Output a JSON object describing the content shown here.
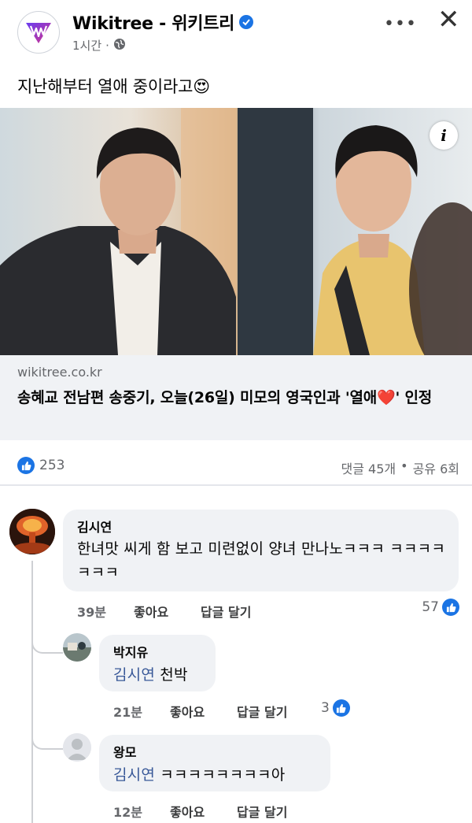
{
  "post": {
    "page_name": "Wikitree - 위키트리",
    "time": "1시간",
    "separator": "·",
    "text": "지난해부터 열애 중이라고",
    "emoji": "😍",
    "link": {
      "domain": "wikitree.co.kr",
      "title_before": "송혜교 전남편 송중기, 오늘(26일) 미모의 영국인과 '열애",
      "heart": "❤️",
      "title_after": "' 인정"
    },
    "reactions": {
      "count": "253"
    },
    "stats": {
      "comments": "댓글 45개",
      "dot": "•",
      "shares": "공유 6회"
    }
  },
  "comments": [
    {
      "author": "김시연",
      "text": "한녀맛 씨게 함 보고 미련없이 양녀 만나노ㅋㅋㅋ ㅋㅋㅋㅋㅋㅋㅋ",
      "time": "39분",
      "like_label": "좋아요",
      "reply_label": "답글 달기",
      "likes": "57"
    },
    {
      "author": "박지유",
      "mention": "김시연",
      "text": "천박",
      "time": "21분",
      "like_label": "좋아요",
      "reply_label": "답글 달기",
      "likes": "3"
    },
    {
      "author": "왕모",
      "mention": "김시연",
      "text": "ㅋㅋㅋㅋㅋㅋㅋㅋ아",
      "time": "12분",
      "like_label": "좋아요",
      "reply_label": "답글 달기"
    }
  ],
  "colors": {
    "accent": "#1b74e4",
    "mention": "#385898",
    "bubble": "#f0f2f5",
    "muted": "#65676b"
  },
  "icons": [
    "wikitree-logo-icon",
    "verified-badge-icon",
    "globe-icon",
    "more-icon",
    "close-icon",
    "info-icon",
    "like-icon",
    "heart-emoji-icon"
  ]
}
